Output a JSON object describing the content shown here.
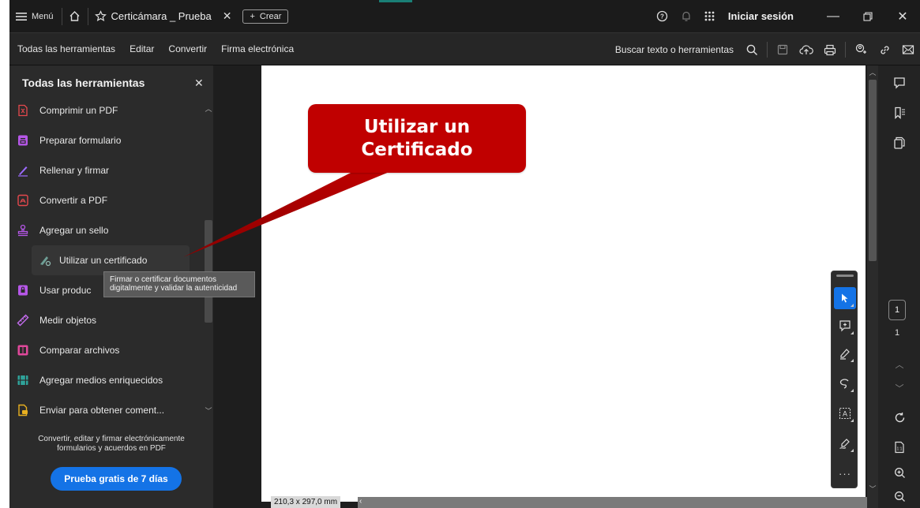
{
  "titlebar": {
    "menu_label": "Menú",
    "tab_title": "Certicámara _ Prueba",
    "create_label": "Crear",
    "signin_label": "Iniciar sesión"
  },
  "toolbar": {
    "links": [
      "Todas las herramientas",
      "Editar",
      "Convertir",
      "Firma electrónica"
    ],
    "search_label": "Buscar texto o herramientas"
  },
  "panel": {
    "title": "Todas las herramientas",
    "tools": [
      {
        "label": "Comprimir un PDF",
        "icon": "compress-pdf-icon",
        "color": "#e5484d"
      },
      {
        "label": "Preparar formulario",
        "icon": "prepare-form-icon",
        "color": "#b657e8"
      },
      {
        "label": "Rellenar y firmar",
        "icon": "fill-sign-icon",
        "color": "#9d6bff"
      },
      {
        "label": "Convertir a PDF",
        "icon": "convert-pdf-icon",
        "color": "#e5484d"
      },
      {
        "label": "Agregar un sello",
        "icon": "stamp-icon",
        "color": "#b657e8"
      },
      {
        "label": "Utilizar un certificado",
        "icon": "certificate-icon",
        "color": "#8fb8b0"
      },
      {
        "label": "Usar produc",
        "icon": "protect-icon",
        "color": "#b657e8"
      },
      {
        "label": "Medir objetos",
        "icon": "measure-icon",
        "color": "#c56cf0"
      },
      {
        "label": "Comparar archivos",
        "icon": "compare-icon",
        "color": "#e0489b"
      },
      {
        "label": "Agregar medios enriquecidos",
        "icon": "rich-media-icon",
        "color": "#2fa39a"
      },
      {
        "label": "Enviar para obtener coment...",
        "icon": "send-comments-icon",
        "color": "#e8b020"
      }
    ],
    "promo_text": "Convertir, editar y firmar electrónicamente formularios y acuerdos en PDF",
    "trial_button": "Prueba gratis de 7 días"
  },
  "tooltip": {
    "line1": "Firmar o certificar documentos",
    "line2": "digitalmente y validar la autenticidad"
  },
  "callout": {
    "line1": "Utilizar un",
    "line2": "Certificado",
    "color": "#c00000"
  },
  "document": {
    "page_size": "210,3 x 297,0 mm"
  },
  "right_rail": {
    "current_page": "1",
    "total_pages": "1"
  },
  "colors": {
    "accent": "#1473e6",
    "background": "#1e1e1e",
    "panel": "#2b2b2b"
  }
}
